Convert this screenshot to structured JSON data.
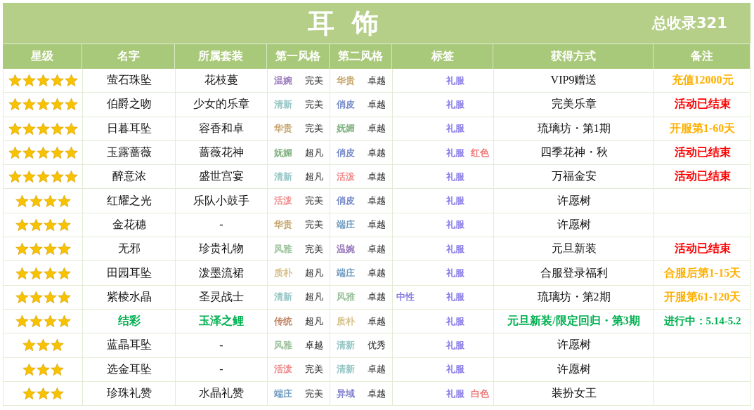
{
  "title": "耳 饰",
  "total": "总收录321",
  "columns": [
    "星级",
    "名字",
    "所属套装",
    "第一风格",
    "第二风格",
    "标签",
    "获得方式",
    "备注"
  ],
  "rows": [
    {
      "stars": 5,
      "name": "萤石珠坠",
      "suit": "花枝蔓",
      "style_1": {
        "text": "温婉",
        "color": "#9b7bbd"
      },
      "rating_1": "完美",
      "style_2": {
        "text": "华贵",
        "color": "#c4a36a"
      },
      "rating_2": "卓越",
      "tag": {
        "text": "礼服",
        "color": "#8a7de8"
      },
      "method": "VIP9赠送",
      "note": {
        "text": "充值12000元",
        "color": "#ffb000"
      },
      "highlight": false
    },
    {
      "stars": 5,
      "name": "伯爵之吻",
      "suit": "少女的乐章",
      "style_1": {
        "text": "清新",
        "color": "#93c4c4"
      },
      "rating_1": "完美",
      "style_2": {
        "text": "俏皮",
        "color": "#7287c8"
      },
      "rating_2": "卓越",
      "tag": {
        "text": "礼服",
        "color": "#8a7de8"
      },
      "method": "完美乐章",
      "note": {
        "text": "活动已结束",
        "color": "#ff0000"
      },
      "highlight": false
    },
    {
      "stars": 5,
      "name": "日暮耳坠",
      "suit": "容香和卓",
      "style_1": {
        "text": "华贵",
        "color": "#c4a36a"
      },
      "rating_1": "完美",
      "style_2": {
        "text": "妩媚",
        "color": "#7fb07f"
      },
      "rating_2": "卓越",
      "tag": {
        "text": "礼服",
        "color": "#8a7de8"
      },
      "method": "琉璃坊・第1期",
      "note": {
        "text": "开服第1-60天",
        "color": "#ffb000"
      },
      "highlight": false
    },
    {
      "stars": 5,
      "name": "玉露蔷薇",
      "suit": "蔷薇花神",
      "style_1": {
        "text": "妩媚",
        "color": "#7fb07f"
      },
      "rating_1": "超凡",
      "style_2": {
        "text": "俏皮",
        "color": "#7287c8"
      },
      "rating_2": "卓越",
      "tag": {
        "text": "礼服",
        "color": "#8a7de8"
      },
      "extra": {
        "text": "红色",
        "color": "#f07878"
      },
      "method": "四季花神・秋",
      "note": {
        "text": "活动已结束",
        "color": "#ff0000"
      },
      "highlight": false
    },
    {
      "stars": 5,
      "name": "醉意浓",
      "suit": "盛世宫宴",
      "style_1": {
        "text": "清新",
        "color": "#93c4c4"
      },
      "rating_1": "超凡",
      "style_2": {
        "text": "活泼",
        "color": "#f08c8c"
      },
      "rating_2": "卓越",
      "tag": {
        "text": "礼服",
        "color": "#8a7de8"
      },
      "method": "万福金安",
      "note": {
        "text": "活动已结束",
        "color": "#ff0000"
      },
      "highlight": false
    },
    {
      "stars": 4,
      "name": "红耀之光",
      "suit": "乐队小鼓手",
      "style_1": {
        "text": "活泼",
        "color": "#f08c8c"
      },
      "rating_1": "完美",
      "style_2": {
        "text": "俏皮",
        "color": "#7287c8"
      },
      "rating_2": "卓越",
      "tag": {
        "text": "礼服",
        "color": "#8a7de8"
      },
      "method": "许愿树",
      "highlight": false
    },
    {
      "stars": 4,
      "name": "金花穗",
      "suit": "-",
      "style_1": {
        "text": "华贵",
        "color": "#c4a36a"
      },
      "rating_1": "完美",
      "style_2": {
        "text": "端庄",
        "color": "#6f9cc0"
      },
      "rating_2": "卓越",
      "tag": {
        "text": "礼服",
        "color": "#8a7de8"
      },
      "method": "许愿树",
      "highlight": false
    },
    {
      "stars": 4,
      "name": "无邪",
      "suit": "珍贵礼物",
      "style_1": {
        "text": "风雅",
        "color": "#9cc39c"
      },
      "rating_1": "完美",
      "style_2": {
        "text": "温婉",
        "color": "#9b7bbd"
      },
      "rating_2": "卓越",
      "tag": {
        "text": "礼服",
        "color": "#8a7de8"
      },
      "method": "元旦新装",
      "note": {
        "text": "活动已结束",
        "color": "#ff0000"
      },
      "highlight": false
    },
    {
      "stars": 4,
      "name": "田园耳坠",
      "suit": "泼墨流裙",
      "style_1": {
        "text": "质朴",
        "color": "#d8c28c"
      },
      "rating_1": "超凡",
      "style_2": {
        "text": "端庄",
        "color": "#6f9cc0"
      },
      "rating_2": "卓越",
      "tag": {
        "text": "礼服",
        "color": "#8a7de8"
      },
      "method": "合服登录福利",
      "note": {
        "text": "合服后第1-15天",
        "color": "#ffb000"
      },
      "highlight": false
    },
    {
      "stars": 4,
      "name": "紫棱水晶",
      "suit": "圣灵战士",
      "style_1": {
        "text": "清新",
        "color": "#93c4c4"
      },
      "rating_1": "超凡",
      "style_2": {
        "text": "风雅",
        "color": "#9cc39c"
      },
      "rating_2": "卓越",
      "gender": {
        "text": "中性",
        "color": "#8a7de8"
      },
      "tag": {
        "text": "礼服",
        "color": "#8a7de8"
      },
      "method": "琉璃坊・第2期",
      "note": {
        "text": "开服第61-120天",
        "color": "#ffb000"
      },
      "highlight": false
    },
    {
      "stars": 4,
      "name": "结彩",
      "suit": "玉泽之鲤",
      "style_1": {
        "text": "传统",
        "color": "#c08466"
      },
      "rating_1": "超凡",
      "style_2": {
        "text": "质朴",
        "color": "#d8c28c"
      },
      "rating_2": "卓越",
      "tag": {
        "text": "礼服",
        "color": "#8a7de8"
      },
      "method": "元旦新装/限定回归・第3期",
      "note": {
        "text": "进行中：5.14-5.2",
        "color": "#00b050"
      },
      "highlight": true
    },
    {
      "stars": 3,
      "name": "蓝晶耳坠",
      "suit": "-",
      "style_1": {
        "text": "风雅",
        "color": "#9cc39c"
      },
      "rating_1": "卓越",
      "style_2": {
        "text": "清新",
        "color": "#93c4c4"
      },
      "rating_2": "优秀",
      "tag": {
        "text": "礼服",
        "color": "#8a7de8"
      },
      "method": "许愿树",
      "highlight": false
    },
    {
      "stars": 3,
      "name": "选金耳坠",
      "suit": "-",
      "style_1": {
        "text": "活泼",
        "color": "#f08c8c"
      },
      "rating_1": "完美",
      "style_2": {
        "text": "清新",
        "color": "#93c4c4"
      },
      "rating_2": "卓越",
      "tag": {
        "text": "礼服",
        "color": "#8a7de8"
      },
      "method": "许愿树",
      "highlight": false
    },
    {
      "stars": 3,
      "name": "珍珠礼赞",
      "suit": "水晶礼赞",
      "style_1": {
        "text": "端庄",
        "color": "#6f9cc0"
      },
      "rating_1": "完美",
      "style_2": {
        "text": "异域",
        "color": "#8080d0"
      },
      "rating_2": "卓越",
      "tag": {
        "text": "礼服",
        "color": "#8a7de8"
      },
      "extra": {
        "text": "白色",
        "color": "#f07878"
      },
      "method": "装扮女王",
      "highlight": false
    }
  ]
}
